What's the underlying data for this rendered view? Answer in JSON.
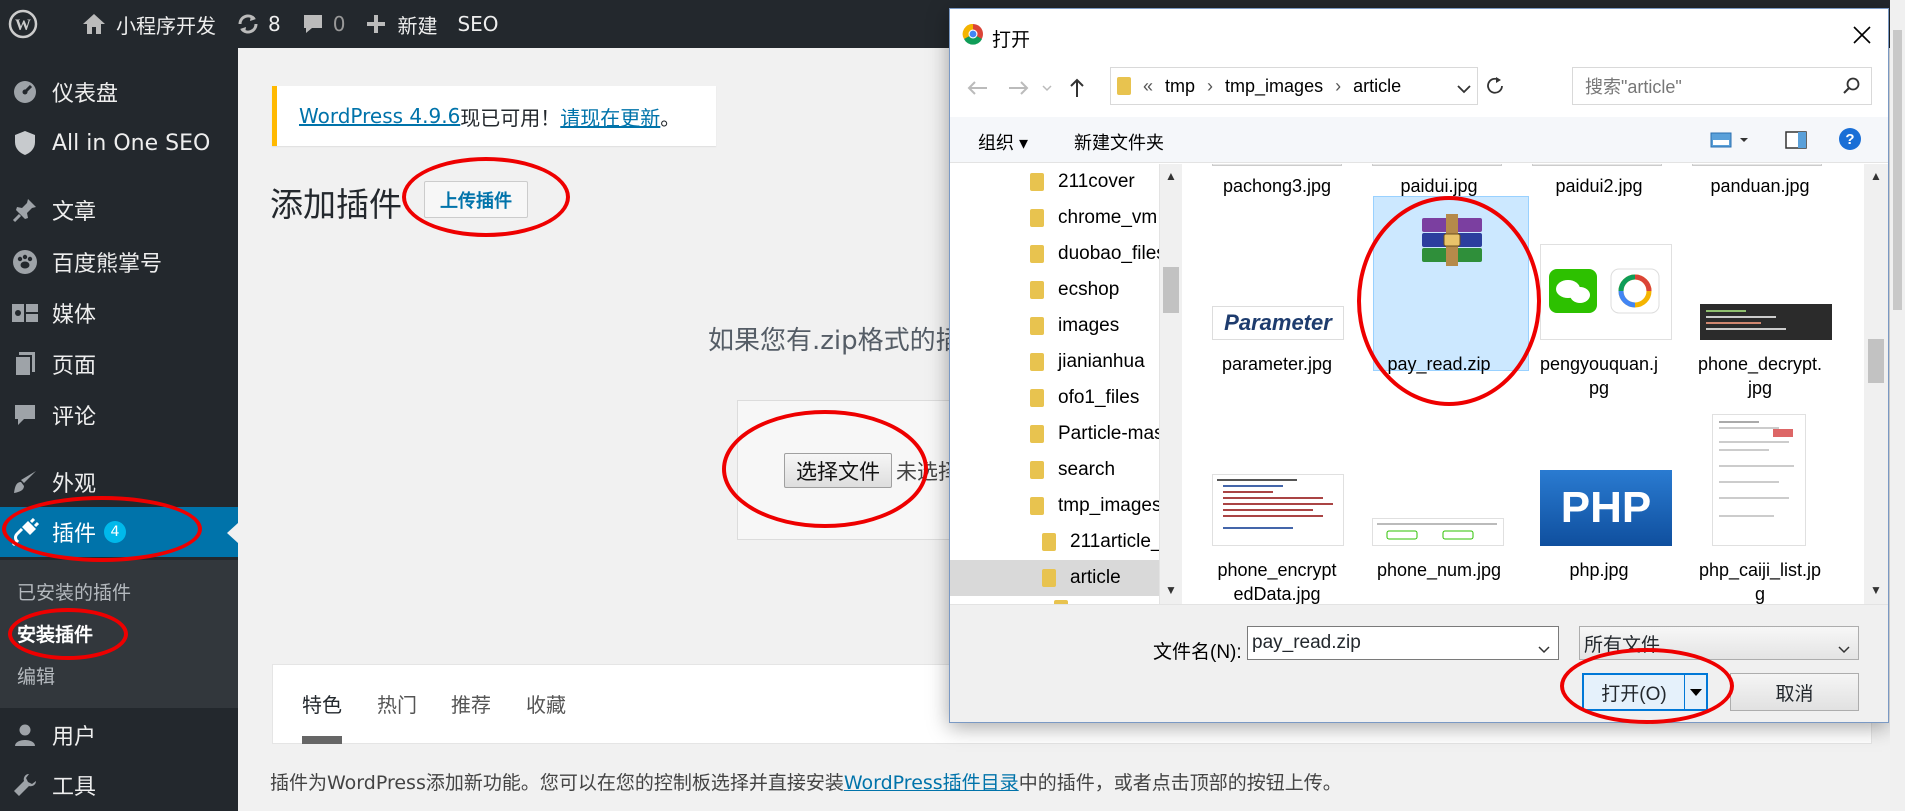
{
  "adminbar": {
    "site_name": "小程序开发",
    "updates_count": "8",
    "comments_count": "0",
    "new_label": "新建",
    "seo_label": "SEO"
  },
  "sidebar": {
    "items": [
      {
        "label": "仪表盘",
        "icon": "dashboard-icon"
      },
      {
        "label": "All in One SEO",
        "icon": "shield-icon"
      },
      {
        "label": "文章",
        "icon": "pin-icon"
      },
      {
        "label": "百度熊掌号",
        "icon": "paw-icon"
      },
      {
        "label": "媒体",
        "icon": "media-icon"
      },
      {
        "label": "页面",
        "icon": "page-icon"
      },
      {
        "label": "评论",
        "icon": "comment-icon"
      },
      {
        "label": "外观",
        "icon": "brush-icon"
      },
      {
        "label": "插件",
        "icon": "plugin-icon",
        "badge": "4"
      },
      {
        "label": "用户",
        "icon": "user-icon"
      },
      {
        "label": "工具",
        "icon": "wrench-icon"
      }
    ],
    "submenu": [
      "已安装的插件",
      "安装插件",
      "编辑"
    ]
  },
  "notice": {
    "version_link": "WordPress 4.9.6",
    "middle": "现已可用！",
    "update_link": "请现在更新",
    "end": "。"
  },
  "main": {
    "page_title": "添加插件",
    "upload_button": "上传插件",
    "upload_desc": "如果您有.zip格式的插",
    "choose_file": "选择文件",
    "no_file": "未选择",
    "tabs": [
      "特色",
      "热门",
      "推荐",
      "收藏"
    ],
    "footer_before": "插件为WordPress添加新功能。您可以在您的控制板选择并直接安装",
    "footer_link": "WordPress插件目录",
    "footer_after": "中的插件，或者点击顶部的按钮上传。"
  },
  "dialog": {
    "title": "打开",
    "address": {
      "prefix": "«",
      "crumbs": [
        "tmp",
        "tmp_images",
        "article"
      ]
    },
    "search_placeholder": "搜索\"article\"",
    "organize": "组织 ▾",
    "new_folder": "新建文件夹",
    "nav_folders": [
      "211cover",
      "chrome_vm",
      "duobao_files",
      "ecshop",
      "images",
      "jianianhua",
      "ofo1_files",
      "Particle-mas",
      "search",
      "tmp_images",
      "211article_",
      "article"
    ],
    "files": [
      {
        "name": "pachong3.jpg"
      },
      {
        "name": "paidui.jpg"
      },
      {
        "name": "paidui2.jpg"
      },
      {
        "name": "panduan.jpg"
      },
      {
        "name": "parameter.jpg",
        "thumb_text": "Parameter"
      },
      {
        "name": "pay_read.zip"
      },
      {
        "name": "pengyouquan.j\npg"
      },
      {
        "name": "phone_decrypt.\njpg"
      },
      {
        "name": "phone_encrypt\nedData.jpg"
      },
      {
        "name": "phone_num.jpg"
      },
      {
        "name": "php.jpg",
        "thumb_text": "PHP"
      },
      {
        "name": "php_caiji_list.jp\ng"
      }
    ],
    "filename_label": "文件名(N):",
    "filename_value": "pay_read.zip",
    "filetype": "所有文件",
    "open_button": "打开(O)",
    "cancel_button": "取消"
  },
  "colors": {
    "wp_dark": "#23282d",
    "wp_blue": "#0073aa",
    "annotation_red": "#ee0000",
    "selection": "#cce8ff"
  }
}
